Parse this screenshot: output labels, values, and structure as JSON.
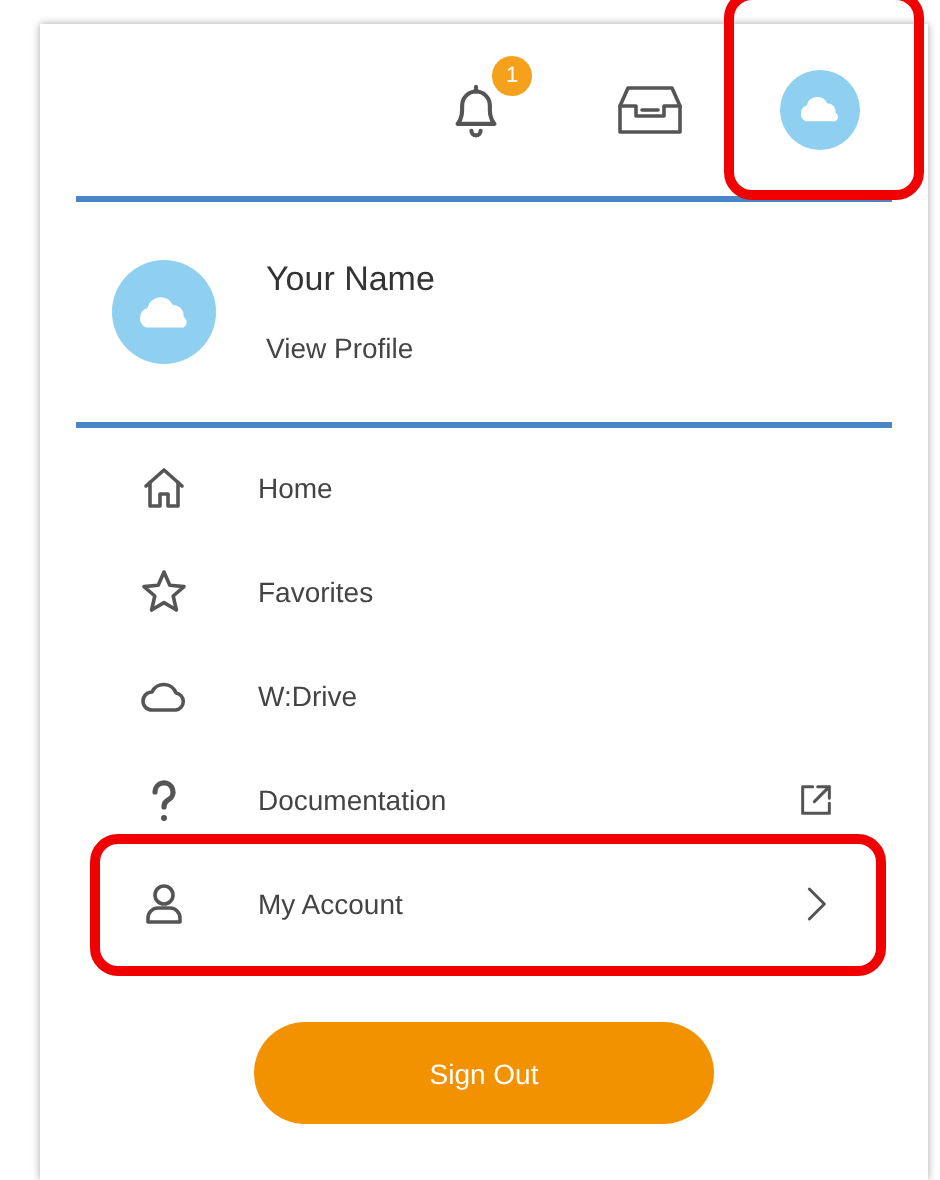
{
  "header": {
    "notification_badge": "1",
    "avatar_highlighted": true
  },
  "profile": {
    "name": "Your Name",
    "link": "View Profile"
  },
  "menu": [
    {
      "label": "Home",
      "kind": "link",
      "highlighted": false
    },
    {
      "label": "Favorites",
      "kind": "link",
      "highlighted": false
    },
    {
      "label": "W:Drive",
      "kind": "link",
      "highlighted": false
    },
    {
      "label": "Documentation",
      "kind": "external",
      "highlighted": false
    },
    {
      "label": "My Account",
      "kind": "submenu",
      "highlighted": true
    }
  ],
  "sign_out": "Sign Out"
}
